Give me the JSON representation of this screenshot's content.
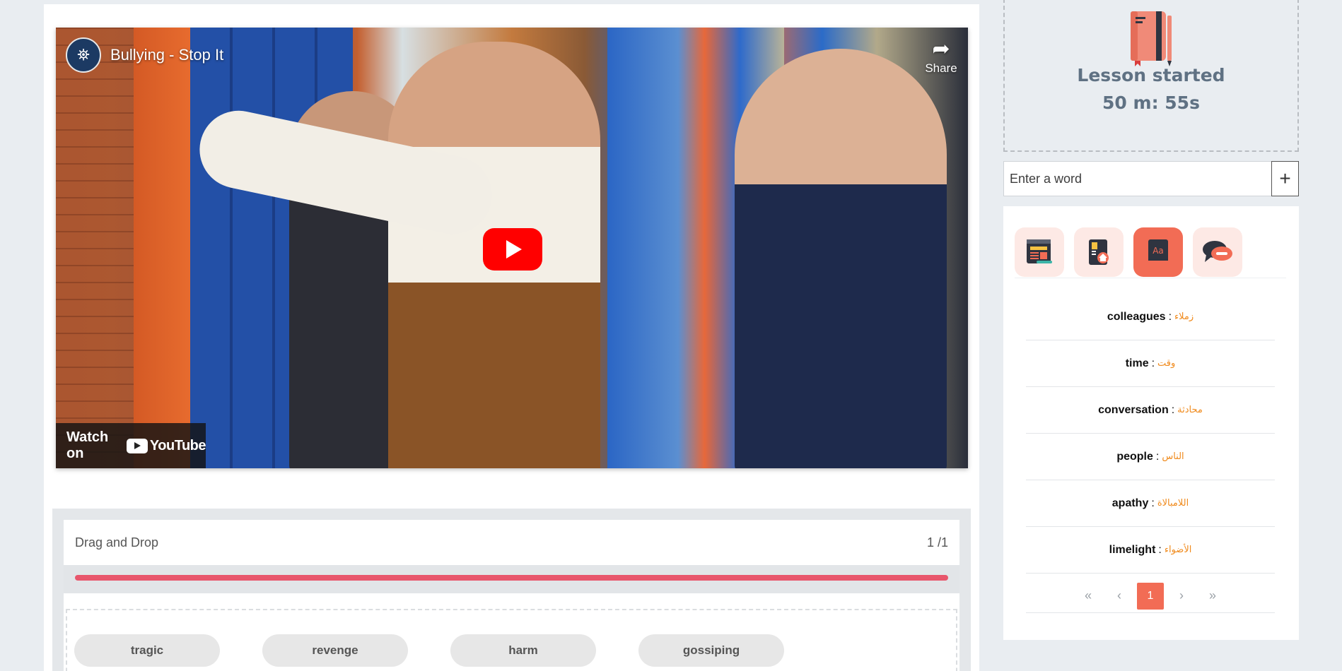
{
  "video": {
    "title": "Bullying - Stop It",
    "share_label": "Share",
    "watch_on_label": "Watch on",
    "youtube_label": "YouTube"
  },
  "drag_and_drop": {
    "title": "Drag and Drop",
    "page_indicator": "1 /1",
    "progress": 1.0,
    "words": [
      "tragic",
      "revenge",
      "harm",
      "gossiping"
    ]
  },
  "lesson": {
    "status_label": "Lesson started",
    "timer": "50 m: 55s"
  },
  "word_input": {
    "placeholder": "Enter a word",
    "add_symbol": "+"
  },
  "tools": [
    {
      "name": "article-tool-icon",
      "active": false
    },
    {
      "name": "homework-tool-icon",
      "active": false
    },
    {
      "name": "dictionary-tool-icon",
      "active": true
    },
    {
      "name": "chat-tool-icon",
      "active": false
    }
  ],
  "vocabulary": [
    {
      "en": "colleagues",
      "ar": "زملاء"
    },
    {
      "en": "time",
      "ar": "وقت"
    },
    {
      "en": "conversation",
      "ar": "محادثة"
    },
    {
      "en": "people",
      "ar": "الناس"
    },
    {
      "en": "apathy",
      "ar": "اللامبالاة"
    },
    {
      "en": "limelight",
      "ar": "الأضواء"
    }
  ],
  "pagination": {
    "first": "«",
    "prev": "‹",
    "current": "1",
    "next": "›",
    "last": "»"
  },
  "colors": {
    "accent": "#f26c55",
    "progress": "#e8566c",
    "arabic_text": "#f08a1c",
    "timer_text": "#5f7183"
  }
}
